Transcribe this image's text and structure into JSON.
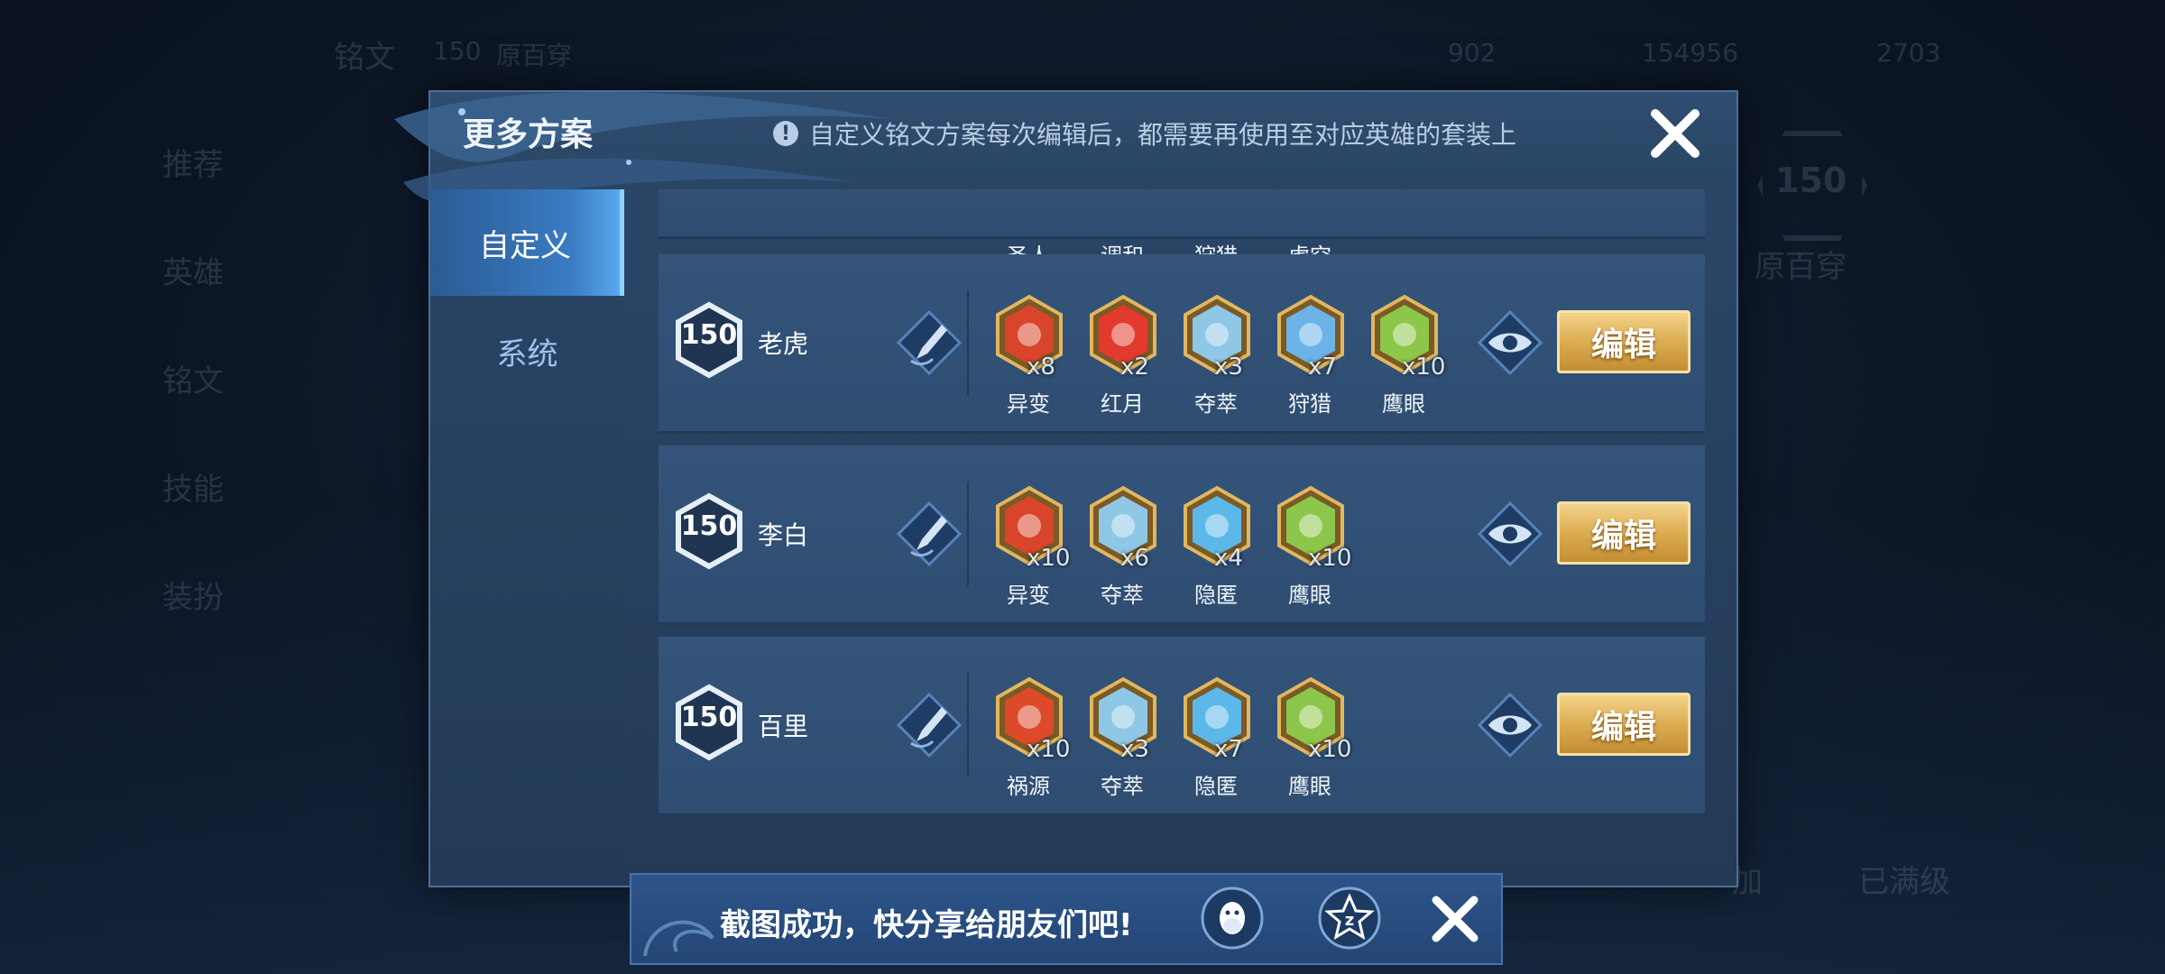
{
  "background": {
    "top_tab": "铭文",
    "top_level": "150",
    "top_player": "原百穿",
    "top_currency_1": "902",
    "top_currency_2": "154956",
    "top_currency_3": "2703",
    "left_menu": [
      "推荐",
      "英雄",
      "铭文",
      "技能",
      "装扮"
    ],
    "right_level": "150",
    "right_name": "原百穿",
    "right_button_1": "加",
    "right_button_2": "已满级"
  },
  "dialog": {
    "title": "更多方案",
    "notice": "自定义铭文方案每次编辑后，都需要再使用至对应英雄的套装上",
    "tabs": [
      "自定义",
      "系统"
    ]
  },
  "partial_row": {
    "runes": [
      {
        "name": "圣人"
      },
      {
        "name": "调和"
      },
      {
        "name": "狩猎"
      },
      {
        "name": "虚空"
      }
    ]
  },
  "rows": [
    {
      "level": "150",
      "hero": "老虎",
      "runes": [
        {
          "name": "异变",
          "count": "x8",
          "color": "#d8452a"
        },
        {
          "name": "红月",
          "count": "x2",
          "color": "#e23b2e"
        },
        {
          "name": "夺萃",
          "count": "x3",
          "color": "#8fc7e6"
        },
        {
          "name": "狩猎",
          "count": "x7",
          "color": "#6cb3e8"
        },
        {
          "name": "鹰眼",
          "count": "x10",
          "color": "#8cc64a"
        }
      ],
      "edit_label": "编辑"
    },
    {
      "level": "150",
      "hero": "李白",
      "runes": [
        {
          "name": "异变",
          "count": "x10",
          "color": "#d8452a"
        },
        {
          "name": "夺萃",
          "count": "x6",
          "color": "#8fc7e6"
        },
        {
          "name": "隐匿",
          "count": "x4",
          "color": "#5db8ea"
        },
        {
          "name": "鹰眼",
          "count": "x10",
          "color": "#8cc64a"
        }
      ],
      "edit_label": "编辑"
    },
    {
      "level": "150",
      "hero": "百里",
      "runes": [
        {
          "name": "祸源",
          "count": "x10",
          "color": "#dd4a2a"
        },
        {
          "name": "夺萃",
          "count": "x3",
          "color": "#8fc7e6"
        },
        {
          "name": "隐匿",
          "count": "x7",
          "color": "#5db8ea"
        },
        {
          "name": "鹰眼",
          "count": "x10",
          "color": "#8cc64a"
        }
      ],
      "edit_label": "编辑"
    }
  ],
  "toast": {
    "text": "截图成功，快分享给朋友们吧!"
  }
}
